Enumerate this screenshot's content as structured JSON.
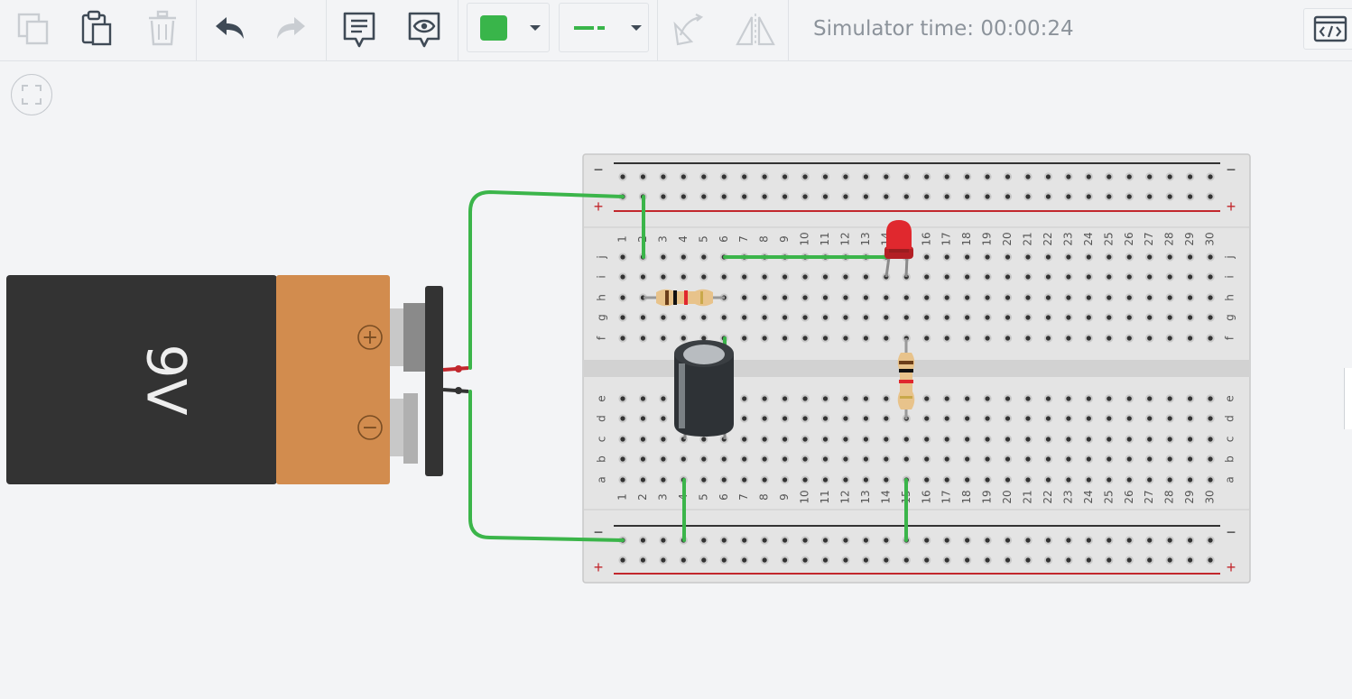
{
  "toolbar": {
    "buttons": [
      {
        "id": "copy",
        "icon": "copy-icon",
        "enabled": false
      },
      {
        "id": "paste",
        "icon": "paste-icon",
        "enabled": true
      },
      {
        "id": "delete",
        "icon": "trash-icon",
        "enabled": false
      },
      {
        "id": "undo",
        "icon": "undo-icon",
        "enabled": true
      },
      {
        "id": "redo",
        "icon": "redo-icon",
        "enabled": false
      },
      {
        "id": "notes",
        "icon": "note-icon",
        "enabled": true
      },
      {
        "id": "notes-visibility",
        "icon": "eye-speech-icon",
        "enabled": true
      },
      {
        "id": "rotate",
        "icon": "rotate-icon",
        "enabled": false
      },
      {
        "id": "flip",
        "icon": "flip-icon",
        "enabled": false
      },
      {
        "id": "code",
        "icon": "code-icon",
        "enabled": true
      }
    ],
    "wire_color": "#39b54a",
    "wire_style": "solid",
    "sim_time_label": "Simulator time: 00:00:24"
  },
  "canvas": {
    "battery": {
      "label": "9V",
      "plus_symbol": "+",
      "minus_symbol": "−"
    },
    "breadboard": {
      "columns": [
        "1",
        "2",
        "3",
        "4",
        "5",
        "6",
        "7",
        "8",
        "9",
        "10",
        "11",
        "12",
        "13",
        "14",
        "15",
        "16",
        "17",
        "18",
        "19",
        "20",
        "21",
        "22",
        "23",
        "24",
        "25",
        "26",
        "27",
        "28",
        "29",
        "30"
      ],
      "top_rows": [
        "j",
        "i",
        "h",
        "g",
        "f"
      ],
      "bottom_rows": [
        "e",
        "d",
        "c",
        "b",
        "a"
      ],
      "rail_minus": "−",
      "rail_plus": "+"
    },
    "colors": {
      "wire": "#3bb54a",
      "rail_red": "#c2272d",
      "rail_black": "#333333",
      "battery_body": "#333333",
      "battery_cap": "#d28c4e",
      "led": "#e0282e"
    }
  }
}
